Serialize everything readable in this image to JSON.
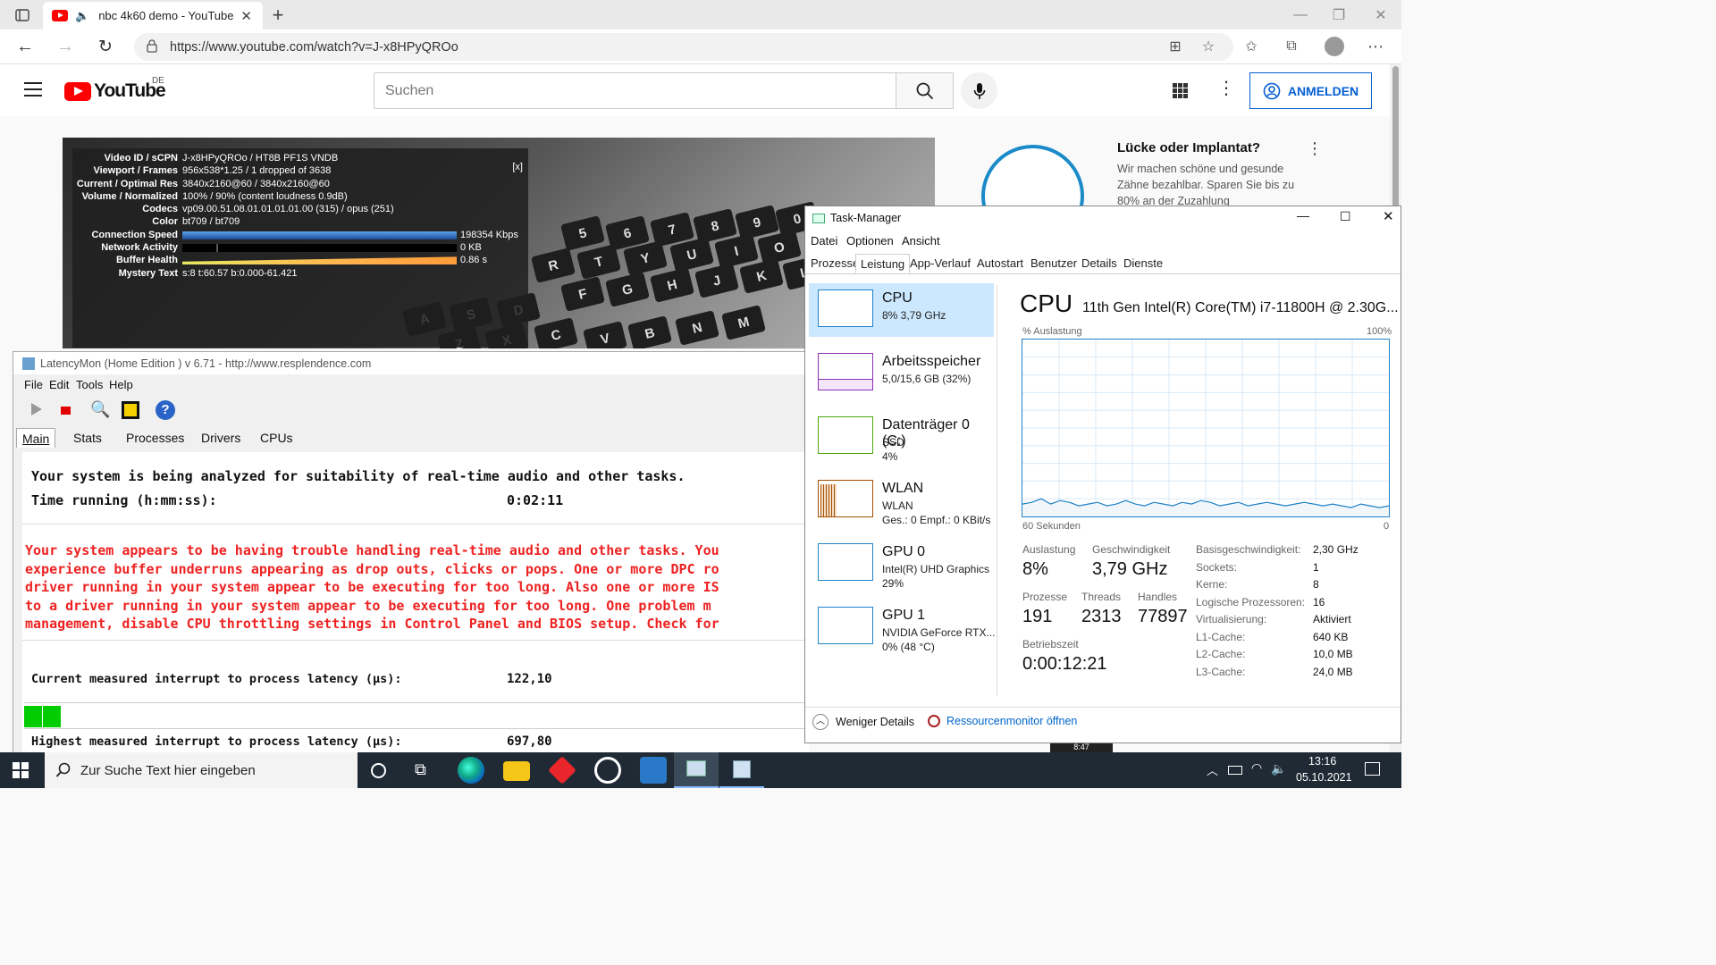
{
  "browser": {
    "tab_title": "nbc 4k60 demo - YouTube",
    "url": "https://www.youtube.com/watch?v=J-x8HPyQROo"
  },
  "youtube": {
    "logo": "YouTube",
    "country": "DE",
    "search_placeholder": "Suchen",
    "signin_label": "ANMELDEN",
    "ad": {
      "title": "Lücke oder Implantat?",
      "text": "Wir machen schöne und gesunde Zähne bezahlbar. Sparen Sie bis zu 80% an der Zuzahlung"
    },
    "stats_close": "[x]",
    "stats": [
      {
        "k": "Video ID / sCPN",
        "v": "J-x8HPyQROo / HT8B PF1S VNDB"
      },
      {
        "k": "Viewport / Frames",
        "v": "956x538*1.25 / 1 dropped of 3638"
      },
      {
        "k": "Current / Optimal Res",
        "v": "3840x2160@60 / 3840x2160@60"
      },
      {
        "k": "Volume / Normalized",
        "v": "100% / 90% (content loudness 0.9dB)"
      },
      {
        "k": "Codecs",
        "v": "vp09.00.51.08.01.01.01.01.00 (315) / opus (251)"
      },
      {
        "k": "Color",
        "v": "bt709 / bt709"
      },
      {
        "k": "Connection Speed",
        "v": "198354 Kbps"
      },
      {
        "k": "Network Activity",
        "v": "0 KB"
      },
      {
        "k": "Buffer Health",
        "v": "0.86 s"
      },
      {
        "k": "Mystery Text",
        "v": "s:8 t:60.57 b:0.000-61.421"
      }
    ],
    "keys": [
      "5",
      "6",
      "7",
      "8",
      "9",
      "0",
      "R",
      "T",
      "Y",
      "U",
      "I",
      "O",
      "F",
      "G",
      "H",
      "J",
      "K",
      "L",
      "A",
      "S",
      "D",
      "V",
      "B",
      "N",
      "M",
      "Z",
      "X",
      "C"
    ]
  },
  "latencymon": {
    "title": "LatencyMon  (Home Edition )  v 6.71 - http://www.resplendence.com",
    "menu": [
      "File",
      "Edit",
      "Tools",
      "Help"
    ],
    "tabs": [
      "Main",
      "Stats",
      "Processes",
      "Drivers",
      "CPUs"
    ],
    "line1": "Your system is being analyzed for suitability of real-time audio and other tasks.",
    "line2_label": "Time running (h:mm:ss):",
    "line2_value": "0:02:11",
    "warning": [
      "Your system appears to be having trouble handling real-time audio and other tasks. You",
      "experience buffer underruns appearing as drop outs, clicks or pops. One or more DPC ro",
      "driver running in your system appear to be executing for too long. Also one or more IS",
      "to a driver running in your system appear to be executing for too long. One problem m",
      "management, disable CPU throttling settings in Control Panel and BIOS setup. Check for"
    ],
    "current_label": "Current measured interrupt to process latency (µs):",
    "current_value": "122,10",
    "highest_label": "Highest measured interrupt to process latency (µs):",
    "highest_value": "697,80"
  },
  "taskmanager": {
    "title": "Task-Manager",
    "menu": [
      "Datei",
      "Optionen",
      "Ansicht"
    ],
    "tabs": [
      "Prozesse",
      "Leistung",
      "App-Verlauf",
      "Autostart",
      "Benutzer",
      "Details",
      "Dienste"
    ],
    "perf_items": [
      {
        "name": "CPU",
        "l2": "8% 3,79 GHz",
        "l3": ""
      },
      {
        "name": "Arbeitsspeicher",
        "l2": "5,0/15,6 GB (32%)",
        "l3": ""
      },
      {
        "name": "Datenträger 0 (C:)",
        "l2": "SSD",
        "l3": "4%"
      },
      {
        "name": "WLAN",
        "l2": "WLAN",
        "l3": "Ges.: 0 Empf.: 0 KBit/s"
      },
      {
        "name": "GPU 0",
        "l2": "Intel(R) UHD Graphics",
        "l3": "29%"
      },
      {
        "name": "GPU 1",
        "l2": "NVIDIA GeForce RTX...",
        "l3": "0% (48 °C)"
      }
    ],
    "cpu_header": "CPU",
    "cpu_model": "11th Gen Intel(R) Core(TM) i7-11800H @ 2.30G...",
    "graph_label": "% Auslastung",
    "graph_max": "100%",
    "graph_time": "60 Sekunden",
    "graph_min": "0",
    "cpu_series": [
      0.07,
      0.08,
      0.1,
      0.07,
      0.09,
      0.08,
      0.06,
      0.07,
      0.08,
      0.06,
      0.07,
      0.09,
      0.07,
      0.06,
      0.08,
      0.07,
      0.06,
      0.08,
      0.07,
      0.09,
      0.08,
      0.06,
      0.07,
      0.08,
      0.06,
      0.07,
      0.08,
      0.07,
      0.06,
      0.07,
      0.08,
      0.07,
      0.06,
      0.07,
      0.06,
      0.05,
      0.07,
      0.06,
      0.05,
      0.06
    ],
    "stats": [
      {
        "label": "Auslastung",
        "value": "8%"
      },
      {
        "label": "Geschwindigkeit",
        "value": "3,79 GHz"
      },
      {
        "label": "Prozesse",
        "value": "191"
      },
      {
        "label": "Threads",
        "value": "2313"
      },
      {
        "label": "Handles",
        "value": "77897"
      },
      {
        "label": "Betriebszeit",
        "value": "0:00:12:21"
      }
    ],
    "details": [
      {
        "k": "Basisgeschwindigkeit:",
        "v": "2,30 GHz"
      },
      {
        "k": "Sockets:",
        "v": "1"
      },
      {
        "k": "Kerne:",
        "v": "8"
      },
      {
        "k": "Logische Prozessoren:",
        "v": "16"
      },
      {
        "k": "Virtualisierung:",
        "v": "Aktiviert"
      },
      {
        "k": "L1-Cache:",
        "v": "640 KB"
      },
      {
        "k": "L2-Cache:",
        "v": "10,0 MB"
      },
      {
        "k": "L3-Cache:",
        "v": "24,0 MB"
      }
    ],
    "fewer_details": "Weniger Details",
    "resource_monitor": "Ressourcenmonitor öffnen"
  },
  "taskbar": {
    "search_placeholder": "Zur Suche Text hier eingeben",
    "time": "13:16",
    "date": "05.10.2021",
    "peek_time": "8:47"
  }
}
